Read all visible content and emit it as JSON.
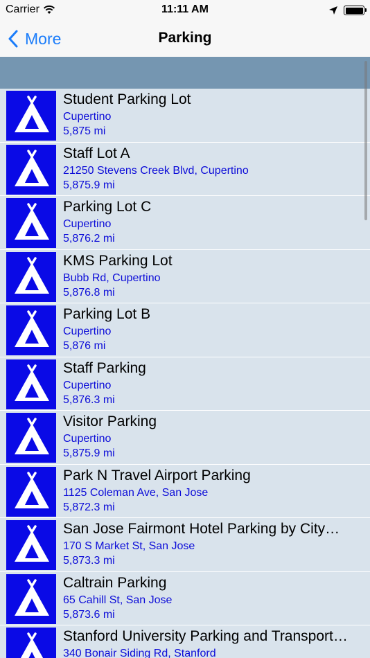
{
  "status_bar": {
    "carrier": "Carrier",
    "time": "11:11 AM"
  },
  "nav": {
    "back_label": "More",
    "title": "Parking"
  },
  "colors": {
    "accent": "#1a7cfa",
    "icon_bg": "#0a0ae6",
    "header_band": "#7596b1",
    "list_bg": "#d9e3ec",
    "subtext": "#0c0cd8"
  },
  "rows": [
    {
      "name": "Student Parking Lot",
      "address": "Cupertino",
      "distance": "5,875 mi",
      "icon": "tent-icon"
    },
    {
      "name": "Staff Lot A",
      "address": "21250 Stevens Creek Blvd, Cupertino",
      "distance": "5,875.9 mi",
      "icon": "tent-icon"
    },
    {
      "name": "Parking Lot C",
      "address": "Cupertino",
      "distance": "5,876.2 mi",
      "icon": "tent-icon"
    },
    {
      "name": "KMS Parking Lot",
      "address": "Bubb Rd, Cupertino",
      "distance": "5,876.8 mi",
      "icon": "tent-icon"
    },
    {
      "name": "Parking Lot B",
      "address": "Cupertino",
      "distance": "5,876 mi",
      "icon": "tent-icon"
    },
    {
      "name": "Staff Parking",
      "address": "Cupertino",
      "distance": "5,876.3 mi",
      "icon": "tent-icon"
    },
    {
      "name": "Visitor Parking",
      "address": "Cupertino",
      "distance": "5,875.9 mi",
      "icon": "tent-icon"
    },
    {
      "name": "Park N Travel Airport Parking",
      "address": "1125 Coleman Ave, San Jose",
      "distance": "5,872.3 mi",
      "icon": "tent-icon"
    },
    {
      "name": "San Jose Fairmont Hotel Parking by City…",
      "address": "170 S Market St, San Jose",
      "distance": "5,873.3 mi",
      "icon": "tent-icon"
    },
    {
      "name": "Caltrain Parking",
      "address": "65 Cahill St, San Jose",
      "distance": "5,873.6 mi",
      "icon": "tent-icon"
    },
    {
      "name": "Stanford University Parking and Transport…",
      "address": "340 Bonair Siding Rd, Stanford",
      "distance": "",
      "icon": "tent-icon"
    }
  ]
}
